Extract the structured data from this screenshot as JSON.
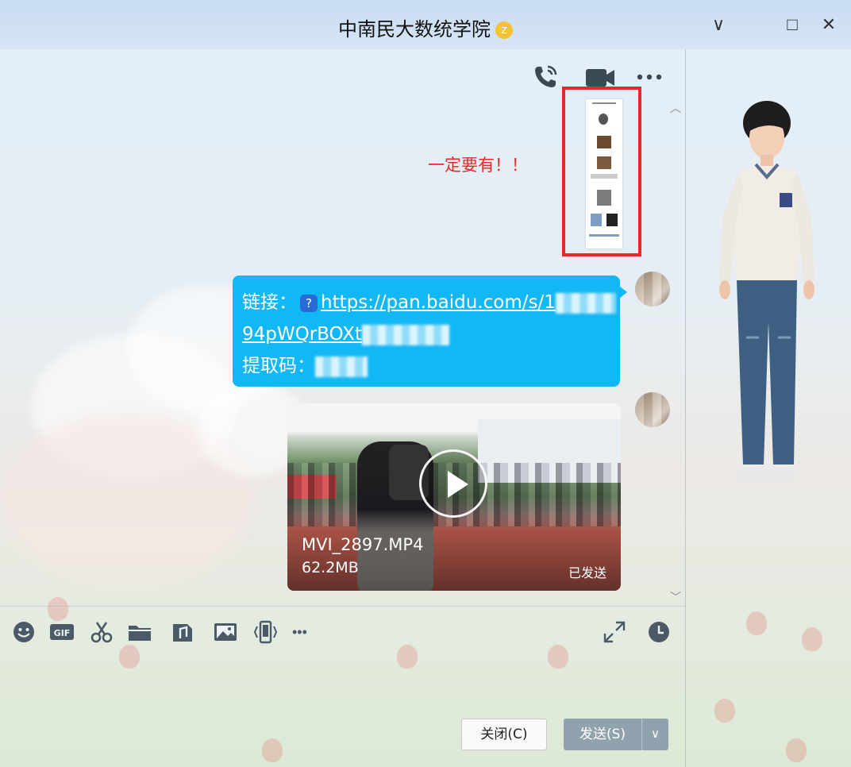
{
  "window": {
    "title": "中南民大数统学院",
    "badge_icon": "z",
    "minimize_symbol": "∨",
    "restore_symbol": "□",
    "close_symbol": "✕"
  },
  "annotation": {
    "text": "一定要有！！",
    "color": "#e52a2a"
  },
  "messages": {
    "link": {
      "label1": "链接：",
      "url_part1": "https://pan.baidu.com/s/1",
      "url_part2": "94pWQrBOXt",
      "label2": "提取码："
    },
    "video": {
      "filename": "MVI_2897.MP4",
      "size": "62.2MB",
      "status": "已发送"
    }
  },
  "toolbar": {
    "more_symbol": "•••"
  },
  "buttons": {
    "close": "关闭(C)",
    "send": "发送(S)",
    "send_dropdown": "∨"
  },
  "colors": {
    "bubble": "#12b7f5",
    "send_button": "#8fa2ad",
    "highlight": "#e52a2a"
  }
}
